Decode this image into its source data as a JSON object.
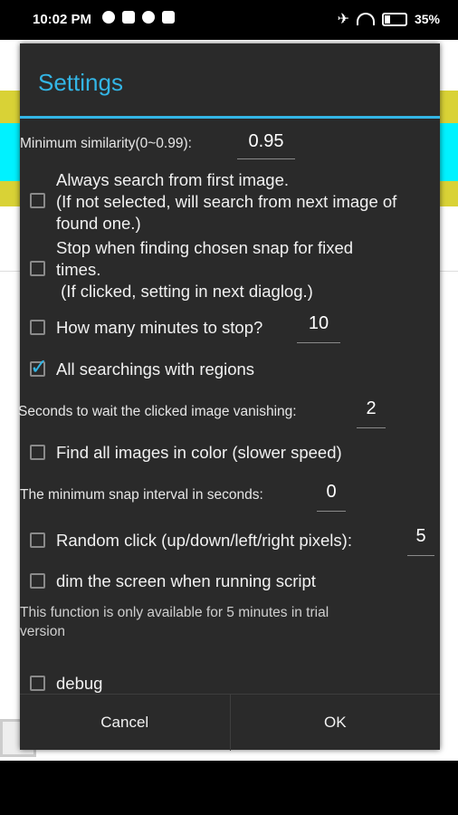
{
  "status_bar": {
    "time": "10:02 PM",
    "battery_percent": "35%",
    "icons": [
      "no-sync-icon",
      "camera-icon",
      "record-icon",
      "app-icon",
      "airplane-icon",
      "wifi-icon",
      "battery-icon"
    ]
  },
  "dialog": {
    "title": "Settings",
    "min_similarity": {
      "label": "Minimum similarity(0~0.99):",
      "value": "0.95"
    },
    "always_first": {
      "label_line1": "Always search from first image.",
      "label_line2": "(If not selected, will search from next image of",
      "label_line3": "found one.)",
      "checked": false
    },
    "stop_chosen": {
      "label_line1": "Stop when finding chosen snap for fixed",
      "label_line2": "times.",
      "label_line3": " (If clicked, setting in next diaglog.)",
      "checked": false
    },
    "minutes_stop": {
      "label": "How many minutes to stop?",
      "value": "10",
      "checked": false
    },
    "regions": {
      "label": "All searchings with regions",
      "checked": true
    },
    "wait_vanish": {
      "label": "Seconds to wait the clicked image vanishing:",
      "value": "2"
    },
    "color_find": {
      "label": "Find all images in color (slower speed)",
      "checked": false
    },
    "snap_interval": {
      "label": "The minimum snap interval in seconds:",
      "value": "0"
    },
    "random_click": {
      "label": "Random click (up/down/left/right pixels):",
      "value": "5",
      "checked": false
    },
    "dim_screen": {
      "label": "dim the screen when running script",
      "checked": false
    },
    "trial_note_line1": "This function is only available for 5 minutes in trial",
    "trial_note_line2": "version",
    "debug": {
      "label": "debug",
      "checked": false
    },
    "cancel_label": "Cancel",
    "ok_label": "OK"
  },
  "colors": {
    "accent": "#33b5e5",
    "dialog_bg": "#2a2a2a",
    "yellow_band": "#d9d236",
    "cyan_band": "#00f2ff"
  }
}
